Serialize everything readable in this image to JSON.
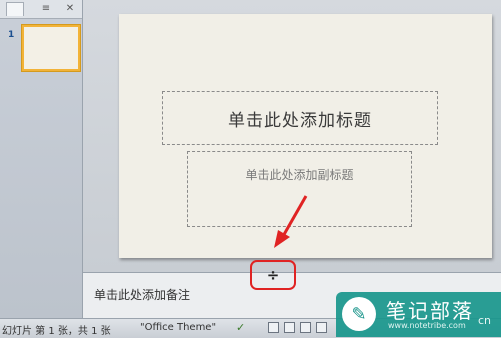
{
  "left_pane": {
    "tab_close": "✕",
    "slide_number": "1"
  },
  "slide": {
    "title_placeholder": "单击此处添加标题",
    "subtitle_placeholder": "单击此处添加副标题"
  },
  "splitter": {
    "glyph": "÷"
  },
  "notes": {
    "placeholder": "单击此处添加备注"
  },
  "status_bar": {
    "slide_info": "幻灯片 第 1 张，共 1 张",
    "theme": "\"Office Theme\""
  },
  "watermark": {
    "name": "笔记部落",
    "url": "www.notetribe.com",
    "suffix": "cn"
  },
  "colors": {
    "annotation_red": "#e02323",
    "thumbnail_selected": "#f2b338",
    "watermark_teal": "#18968c"
  }
}
